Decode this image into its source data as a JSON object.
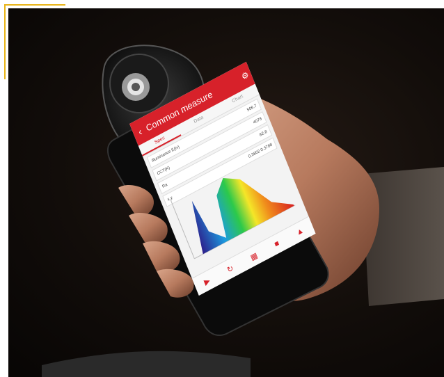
{
  "app": {
    "title": "Common measure",
    "tabs": [
      "Spec",
      "Data",
      "Chart"
    ],
    "values": [
      {
        "label": "Illuminance E(lx)",
        "value": "506.7"
      },
      {
        "label": "CCT(K)",
        "value": "4078"
      },
      {
        "label": "Ra",
        "value": "82.8"
      },
      {
        "label": "x,y",
        "value": "0.3802 0.3788"
      }
    ],
    "icons": [
      "back-arrow",
      "gear",
      "play",
      "repeat",
      "grid",
      "pdf",
      "chart"
    ]
  },
  "colors": {
    "brand_red": "#d7212a",
    "accent_yellow": "#e8b418"
  }
}
